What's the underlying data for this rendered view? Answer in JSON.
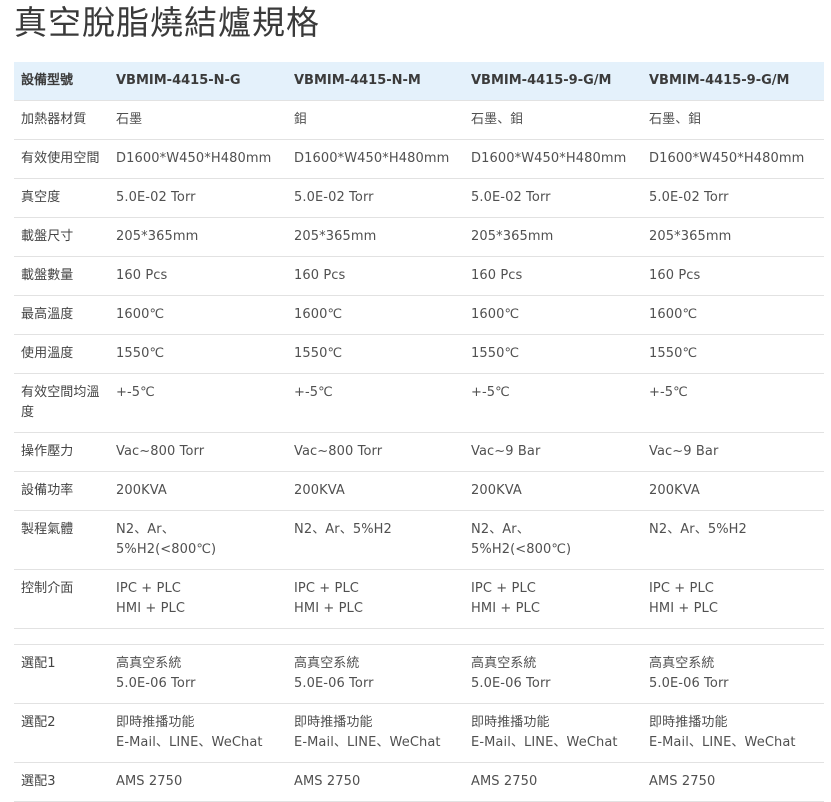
{
  "page": {
    "title": "真空脫脂燒結爐規格"
  },
  "table": {
    "header": [
      "設備型號",
      "VBMIM-4415-N-G",
      "VBMIM-4415-N-M",
      "VBMIM-4415-9-G/M",
      "VBMIM-4415-9-G/M"
    ],
    "rows": [
      {
        "label": "加熱器材質",
        "cells": [
          [
            "石墨"
          ],
          [
            "鉬"
          ],
          [
            "石墨、鉬"
          ],
          [
            "石墨、鉬"
          ]
        ]
      },
      {
        "label": "有效使用空間",
        "cells": [
          [
            "D1600*W450*H480mm"
          ],
          [
            "D1600*W450*H480mm"
          ],
          [
            "D1600*W450*H480mm"
          ],
          [
            "D1600*W450*H480mm"
          ]
        ]
      },
      {
        "label": "真空度",
        "cells": [
          [
            "5.0E-02 Torr"
          ],
          [
            "5.0E-02 Torr"
          ],
          [
            "5.0E-02 Torr"
          ],
          [
            "5.0E-02 Torr"
          ]
        ]
      },
      {
        "label": "載盤尺寸",
        "cells": [
          [
            "205*365mm"
          ],
          [
            "205*365mm"
          ],
          [
            "205*365mm"
          ],
          [
            "205*365mm"
          ]
        ]
      },
      {
        "label": "載盤數量",
        "cells": [
          [
            "160 Pcs"
          ],
          [
            "160 Pcs"
          ],
          [
            "160 Pcs"
          ],
          [
            "160 Pcs"
          ]
        ]
      },
      {
        "label": "最高溫度",
        "cells": [
          [
            "1600℃"
          ],
          [
            "1600℃"
          ],
          [
            "1600℃"
          ],
          [
            "1600℃"
          ]
        ]
      },
      {
        "label": "使用溫度",
        "cells": [
          [
            "1550℃"
          ],
          [
            "1550℃"
          ],
          [
            "1550℃"
          ],
          [
            "1550℃"
          ]
        ]
      },
      {
        "label": "有效空間均溫度",
        "cells": [
          [
            "+-5℃"
          ],
          [
            "+-5℃"
          ],
          [
            "+-5℃"
          ],
          [
            "+-5℃"
          ]
        ]
      },
      {
        "label": "操作壓力",
        "cells": [
          [
            "Vac~800 Torr"
          ],
          [
            "Vac~800 Torr"
          ],
          [
            "Vac~9 Bar"
          ],
          [
            "Vac~9 Bar"
          ]
        ]
      },
      {
        "label": "設備功率",
        "cells": [
          [
            "200KVA"
          ],
          [
            "200KVA"
          ],
          [
            "200KVA"
          ],
          [
            "200KVA"
          ]
        ]
      },
      {
        "label": "製程氣體",
        "cells": [
          [
            "N2、Ar、",
            "5%H2(<800℃)"
          ],
          [
            "N2、Ar、5%H2"
          ],
          [
            "N2、Ar、",
            "5%H2(<800℃)"
          ],
          [
            "N2、Ar、5%H2"
          ]
        ]
      },
      {
        "label": "控制介面",
        "cells": [
          [
            "IPC + PLC",
            "HMI + PLC"
          ],
          [
            "IPC + PLC",
            "HMI + PLC"
          ],
          [
            "IPC + PLC",
            "HMI + PLC"
          ],
          [
            "IPC + PLC",
            "HMI + PLC"
          ]
        ]
      },
      {
        "spacer": true
      },
      {
        "label": "選配1",
        "cells": [
          [
            "高真空系統",
            "5.0E-06 Torr"
          ],
          [
            "高真空系統",
            "5.0E-06 Torr"
          ],
          [
            "高真空系統",
            "5.0E-06 Torr"
          ],
          [
            "高真空系統",
            "5.0E-06 Torr"
          ]
        ]
      },
      {
        "label": "選配2",
        "cells": [
          [
            "即時推播功能",
            "E-Mail、LINE、WeChat"
          ],
          [
            "即時推播功能",
            "E-Mail、LINE、WeChat"
          ],
          [
            "即時推播功能",
            "E-Mail、LINE、WeChat"
          ],
          [
            "即時推播功能",
            "E-Mail、LINE、WeChat"
          ]
        ]
      },
      {
        "label": "選配3",
        "cells": [
          [
            "AMS 2750"
          ],
          [
            "AMS 2750"
          ],
          [
            "AMS 2750"
          ],
          [
            "AMS 2750"
          ]
        ]
      }
    ]
  }
}
